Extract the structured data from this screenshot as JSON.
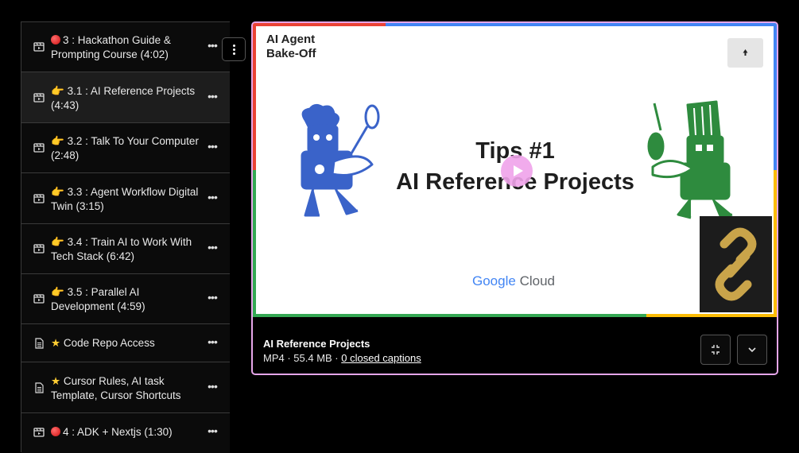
{
  "playlist": {
    "items": [
      {
        "label": "3 : Hackathon Guide & Prompting Course (4:02)",
        "prefix": "red-circle-emoji",
        "icon": "video-file-icon"
      },
      {
        "label": "3.1 : AI Reference Projects (4:43)",
        "prefix": "pointing-hand-emoji",
        "icon": "video-file-icon",
        "active": true
      },
      {
        "label": "3.2 : Talk To Your Computer (2:48)",
        "prefix": "pointing-hand-emoji",
        "icon": "video-file-icon"
      },
      {
        "label": "3.3 : Agent Workflow Digital Twin (3:15)",
        "prefix": "pointing-hand-emoji",
        "icon": "video-file-icon"
      },
      {
        "label": "3.4 : Train AI to Work With Tech Stack (6:42)",
        "prefix": "pointing-hand-emoji",
        "icon": "video-file-icon"
      },
      {
        "label": "3.5 : Parallel AI Development (4:59)",
        "prefix": "pointing-hand-emoji",
        "icon": "video-file-icon"
      },
      {
        "label": "Code Repo Access",
        "prefix": "star-emoji",
        "icon": "document-icon"
      },
      {
        "label": "Cursor Rules, AI task Template, Cursor Shortcuts",
        "prefix": "star-emoji",
        "icon": "document-icon"
      },
      {
        "label": "4 : ADK + Nextjs (1:30)",
        "prefix": "red-circle-emoji",
        "icon": "video-file-icon"
      }
    ],
    "more_glyph": "•••"
  },
  "player": {
    "thumbnail": {
      "brand_line1": "AI Agent",
      "brand_line2": "Bake-Off",
      "headline_line1": "Tips #1",
      "headline_line2": "AI Reference Projects",
      "google_g": "Google",
      "google_cloud": "Cloud"
    },
    "title": "AI Reference Projects",
    "meta": "MP4 · 55.4 MB · ",
    "captions_link": "0 closed captions",
    "colors": {
      "border": "#e6a6e9",
      "red": "#ea4335",
      "blue": "#4285f4",
      "green": "#34a853",
      "yellow": "#fbbc05",
      "mascot_blue": "#3a63c9",
      "mascot_green": "#2e8b3e",
      "play": "#f0a3ea"
    }
  }
}
